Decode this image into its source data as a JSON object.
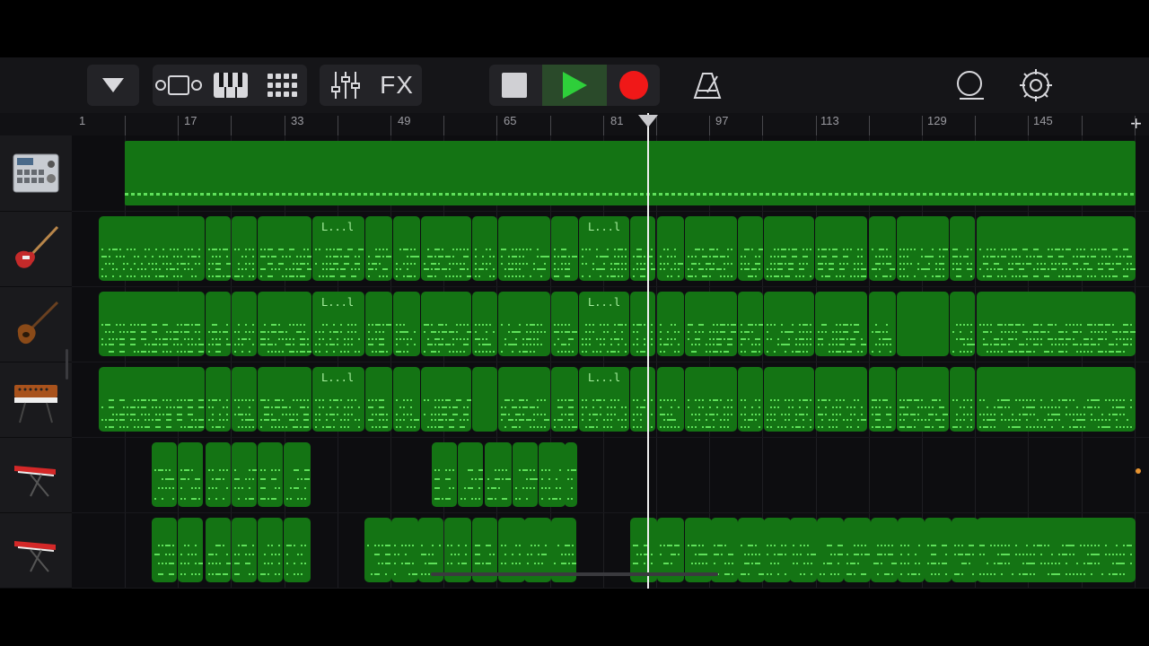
{
  "toolbar": {
    "fx_label": "FX",
    "icons": [
      "chevron-down-icon",
      "tracks-view-icon",
      "keyboard-icon",
      "grid-icon",
      "mixer-icon",
      "fx-button",
      "stop-icon",
      "play-icon",
      "record-icon",
      "metronome-icon",
      "loop-icon",
      "settings-icon"
    ],
    "colors": {
      "play": "#2ecf3a",
      "record": "#f01818",
      "play_bg": "#2a4a2a"
    }
  },
  "ruler": {
    "bars": [
      "1",
      "17",
      "33",
      "49",
      "65",
      "81",
      "97",
      "113",
      "129",
      "145"
    ],
    "add_track_label": "+"
  },
  "tracks": [
    {
      "instrument": "drum-machine-icon"
    },
    {
      "instrument": "bass-guitar-icon"
    },
    {
      "instrument": "violin-bass-icon"
    },
    {
      "instrument": "synth-keyboard-icon"
    },
    {
      "instrument": "keyboard-stand-icon"
    },
    {
      "instrument": "keyboard-stand-icon"
    }
  ],
  "region_labels": {
    "loop_a": "L...l",
    "loop_b": "L...l"
  },
  "colors": {
    "region": "#147414",
    "note": "#5fe05a",
    "playhead": "#f0f0f0",
    "accent_dot": "#e89430"
  }
}
